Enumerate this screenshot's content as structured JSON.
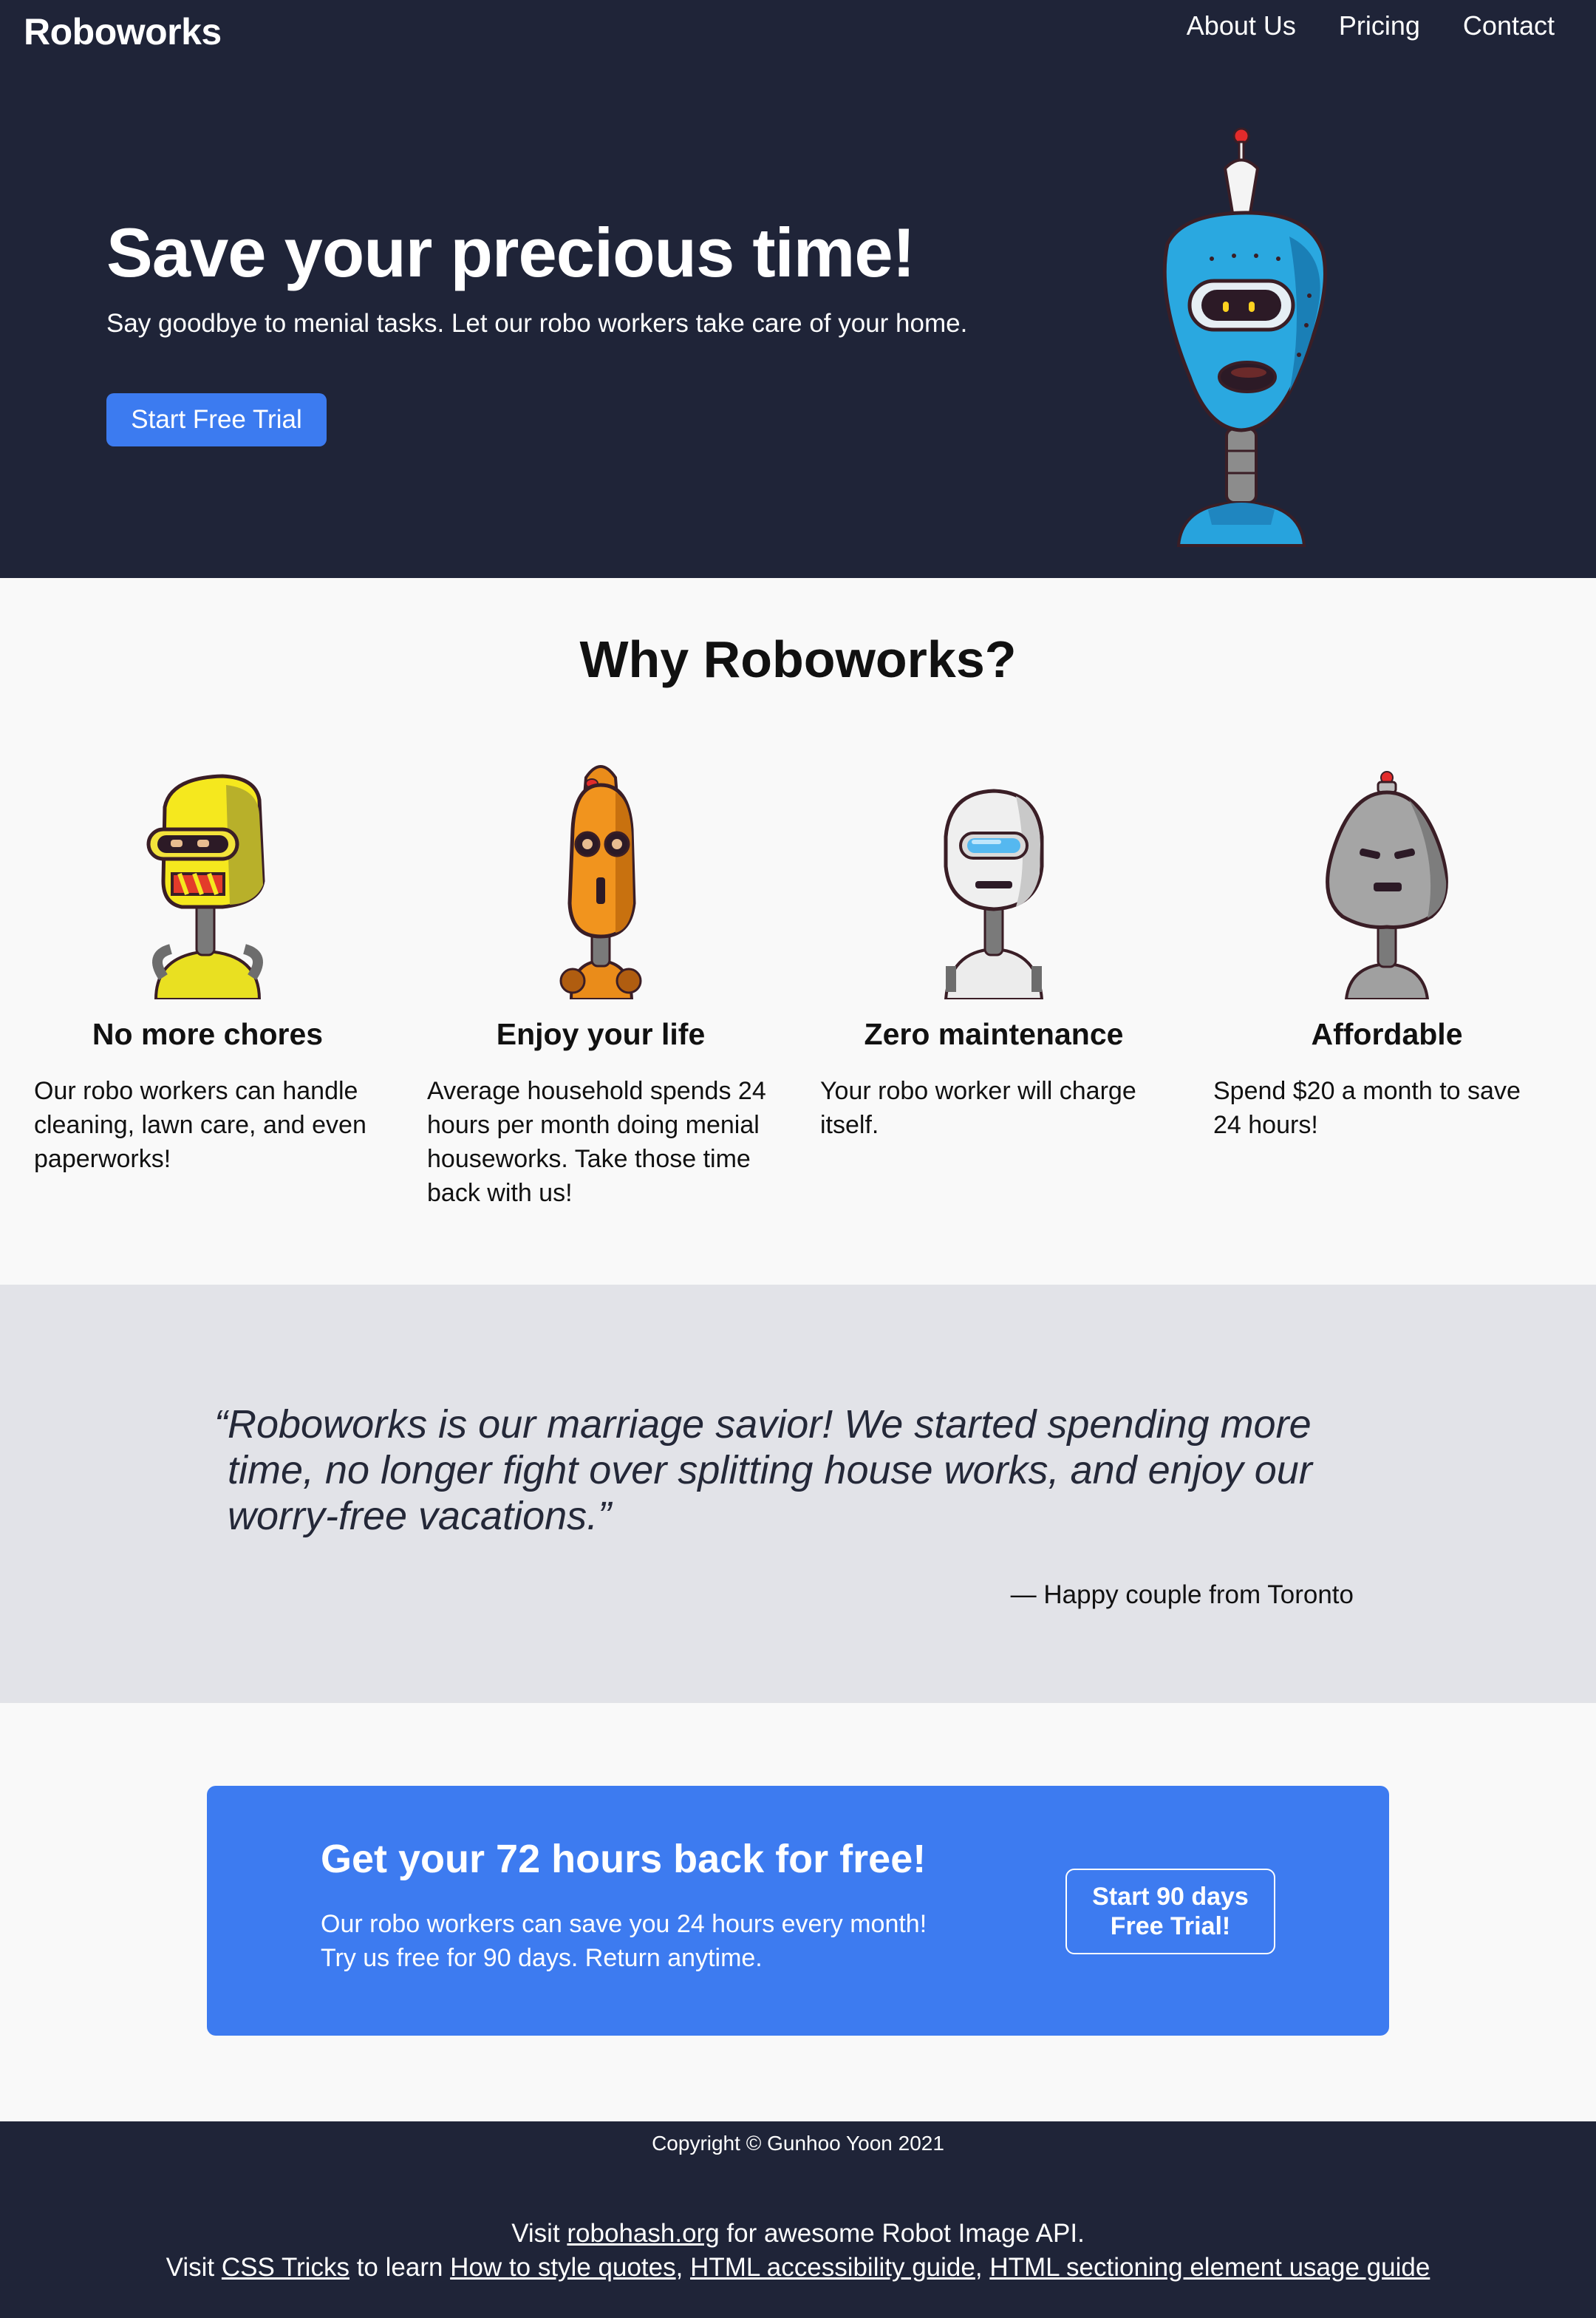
{
  "header": {
    "brand": "Roboworks",
    "nav": [
      "About Us",
      "Pricing",
      "Contact"
    ]
  },
  "hero": {
    "title": "Save your precious time!",
    "subtitle": "Say goodbye to menial tasks. Let our robo workers take care of your home.",
    "cta": "Start Free Trial"
  },
  "features": {
    "title": "Why Roboworks?",
    "items": [
      {
        "title": "No more chores",
        "text": "Our robo workers can handle cleaning, lawn care, and even paperworks!"
      },
      {
        "title": "Enjoy your life",
        "text": "Average household spends 24 hours per month doing menial houseworks. Take those time back with us!"
      },
      {
        "title": "Zero maintenance",
        "text": "Your robo worker will charge itself."
      },
      {
        "title": "Affordable",
        "text": "Spend $20 a month to save 24 hours!"
      }
    ]
  },
  "testimonial": {
    "quote": "“Roboworks is our marriage savior! We started spending more time, no longer fight over splitting house works, and enjoy our worry-free vacations.”",
    "author": "— Happy couple from Toronto"
  },
  "cta": {
    "title": "Get your 72 hours back for free!",
    "line1": "Our robo workers can save you 24 hours every month!",
    "line2": "Try us free for 90 days. Return anytime.",
    "button_line1": "Start 90 days",
    "button_line2": "Free Trial!"
  },
  "footer": {
    "copyright": "Copyright © Gunhoo Yoon 2021",
    "line1_prefix": "Visit ",
    "line1_link": "robohash.org",
    "line1_suffix": " for awesome Robot Image API.",
    "line2_prefix": "Visit ",
    "line2_link1": "CSS Tricks",
    "line2_mid": " to learn ",
    "line2_link2": "How to style quotes",
    "sep1": ", ",
    "line2_link3": "HTML accessibility guide",
    "sep2": ", ",
    "line2_link4": "HTML sectioning element usage guide"
  }
}
